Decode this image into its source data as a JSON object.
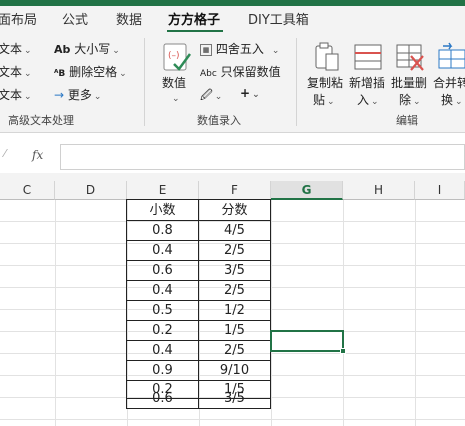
{
  "ribbon": {
    "tabs": [
      "面布局",
      "公式",
      "数据",
      "方方格子",
      "DIY工具箱"
    ],
    "active_tab_index": 3,
    "text_group": {
      "items": [
        "文本",
        "文本",
        "文本"
      ],
      "label": "高级文本处理",
      "case_label": "大小写",
      "delete_space_label": "删除空格",
      "more_label": "更多"
    },
    "numeric_group": {
      "value_label": "数值",
      "round_label": "四舍五入",
      "keep_value_label": "只保留数值",
      "label": "数值录入"
    },
    "edit_group": {
      "copy_paste_label": [
        "复制粘",
        "贴"
      ],
      "insert_label": [
        "新增插",
        "入"
      ],
      "delete_label": [
        "批量删",
        "除"
      ],
      "merge_label": [
        "合并转",
        "换"
      ],
      "label": "编辑"
    }
  },
  "formula_bar": {
    "fx_label": "fx",
    "value": ""
  },
  "grid": {
    "columns": [
      "C",
      "D",
      "E",
      "F",
      "G",
      "H",
      "I"
    ],
    "selected_column": "G",
    "header_row": [
      "小数",
      "分数"
    ],
    "rows": [
      [
        "0.8",
        "4/5"
      ],
      [
        "0.4",
        "2/5"
      ],
      [
        "0.6",
        "3/5"
      ],
      [
        "0.4",
        "2/5"
      ],
      [
        "0.5",
        "1/2"
      ],
      [
        "0.2",
        "1/5"
      ],
      [
        "0.4",
        "2/5"
      ],
      [
        "0.9",
        "9/10"
      ],
      [
        "0.2",
        "1/5"
      ],
      [
        "0.6",
        "3/5"
      ]
    ]
  },
  "colors": {
    "accent": "#217346",
    "ribbon_bg": "#f3f3f3",
    "red_icon": "#d9534f",
    "blue_icon": "#2b78c5"
  }
}
